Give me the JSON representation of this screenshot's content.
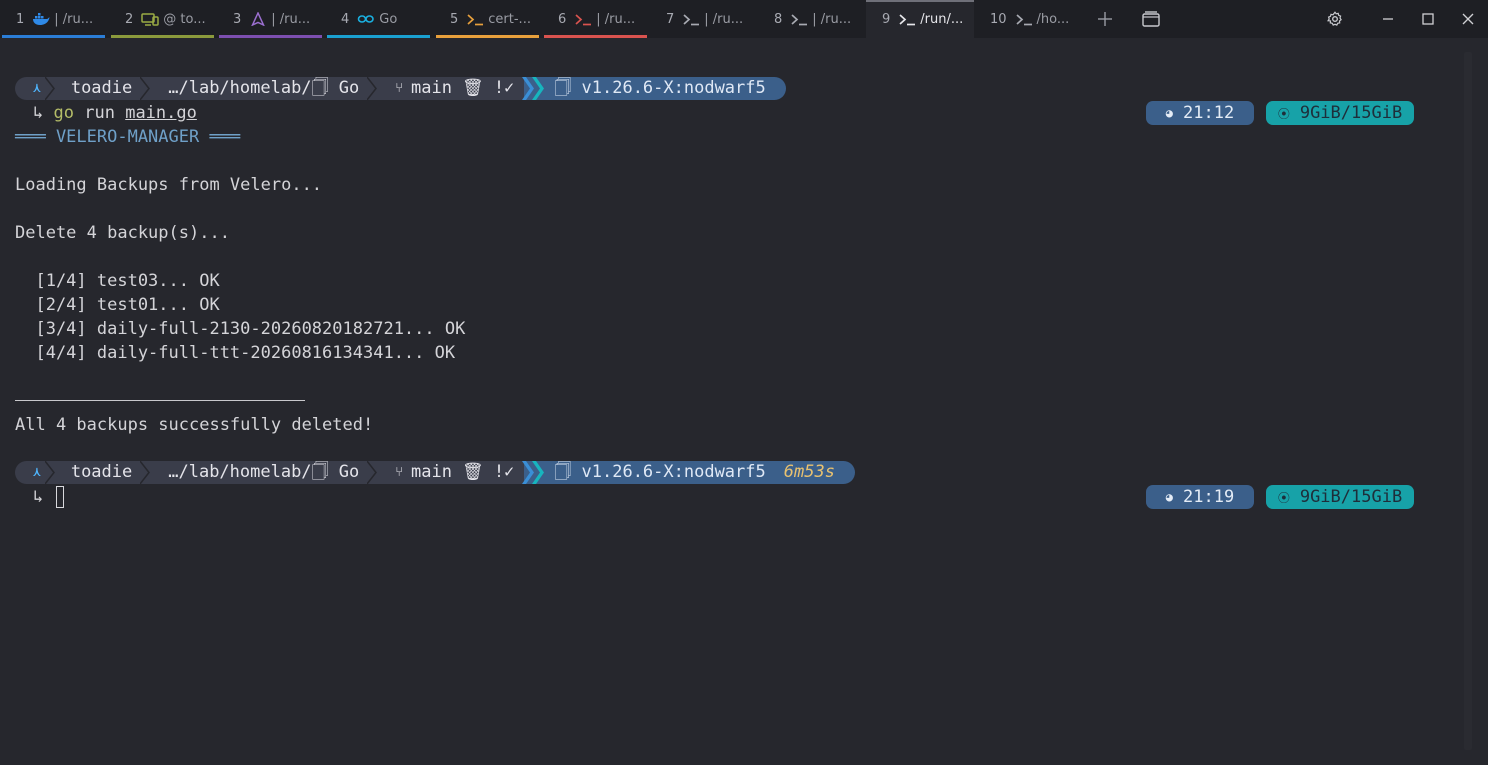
{
  "tabs": [
    {
      "num": "1",
      "icon": "docker-icon",
      "title": "| /ru...",
      "color": "#2b7dd6"
    },
    {
      "num": "2",
      "icon": "devices-icon",
      "title": "@ to...",
      "color": "#8b9a3c"
    },
    {
      "num": "3",
      "icon": "arch-icon",
      "title": "| /ru...",
      "color": "#7d4fb0"
    },
    {
      "num": "4",
      "icon": "go-icon",
      "title": "Go",
      "color": "#1aa0d0"
    },
    {
      "num": "5",
      "icon": "terminal-icon",
      "title": "cert-...",
      "color": "#e8a03c"
    },
    {
      "num": "6",
      "icon": "terminal-icon",
      "title": "| /ru...",
      "color": "#d9534f"
    },
    {
      "num": "7",
      "icon": "terminal-icon",
      "title": "| /ru...",
      "color": ""
    },
    {
      "num": "8",
      "icon": "terminal-icon",
      "title": "| /ru...",
      "color": ""
    },
    {
      "num": "9",
      "icon": "terminal-icon",
      "title": "/run/...",
      "color": "",
      "active": true
    },
    {
      "num": "10",
      "icon": "terminal-icon",
      "title": "/ho...",
      "color": ""
    }
  ],
  "prompt1": {
    "user": "toadie",
    "path": "…/lab/homelab/🗍 Go",
    "branch": "main",
    "git_status": "🗑 !✓",
    "go_version": "🗍 v1.26.6-X:nodwarf5",
    "duration": "",
    "time": "21:12",
    "memory": "9GiB/15GiB"
  },
  "command": {
    "arrow": "↳",
    "cmd": "go",
    "arg1": "run",
    "arg2": "main.go"
  },
  "output": [
    "═══ VELERO-MANAGER ═══",
    "",
    "Loading Backups from Velero...",
    "",
    "Delete 4 backup(s)...",
    "",
    "  [1/4] test03... OK",
    "  [2/4] test01... OK",
    "  [3/4] daily-full-2130-20260820182721... OK",
    "  [4/4] daily-full-ttt-20260816134341... OK",
    "",
    "",
    "All 4 backups successfully deleted!"
  ],
  "prompt2": {
    "user": "toadie",
    "path": "…/lab/homelab/🗍 Go",
    "branch": "main",
    "git_status": "🗑 !✓",
    "go_version": "🗍 v1.26.6-X:nodwarf5",
    "duration": "6m53s",
    "time": "21:19",
    "memory": "9GiB/15GiB"
  },
  "prompt_arrow": "↳",
  "colors": {
    "background": "#26272d",
    "tabbar": "#1e1f24",
    "segment": "#3a3d4a",
    "go_segment": "#3b5f8a",
    "memory": "#17a2a8",
    "duration": "#e8c170",
    "go_cmd": "#b5bd68"
  }
}
